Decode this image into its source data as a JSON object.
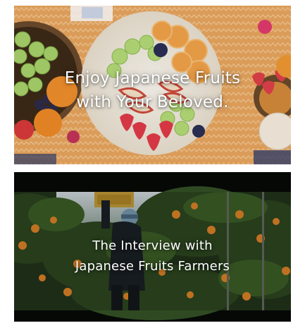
{
  "cards": [
    {
      "line1": "Enjoy Japanese Fruits",
      "line2": "with Your Beloved.",
      "image": "fruit-platter-photo"
    },
    {
      "line1": "The Interview with",
      "line2": "Japanese Fruits Farmers",
      "image": "orange-orchard-farmer-photo"
    }
  ],
  "colors": {
    "tablecloth": "#e7a35f",
    "plate": "#f4efe4",
    "orange": "#f0902c",
    "grape_green": "#a7d36a",
    "orchard_dark": "#1e2a16",
    "caption_text": "#ffffff"
  }
}
